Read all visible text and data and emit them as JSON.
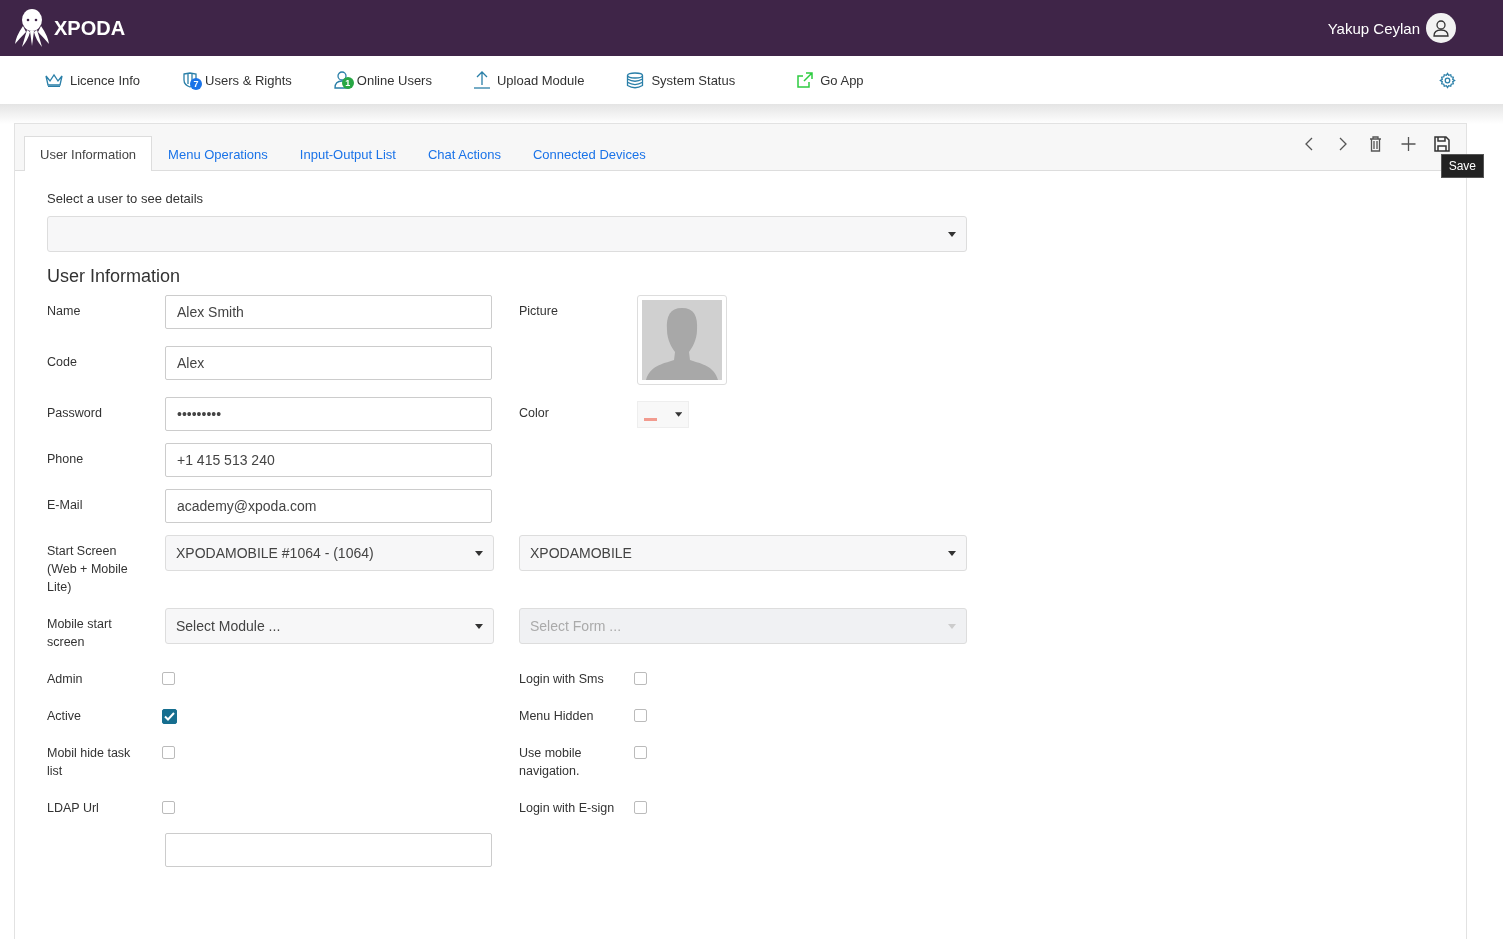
{
  "header": {
    "brand": "XPODA",
    "user_name": "Yakup Ceylan"
  },
  "nav": [
    {
      "kind": "crown",
      "label": "Licence Info"
    },
    {
      "kind": "shield",
      "label": "Users & Rights",
      "badge": "7",
      "color": "#1a73e8"
    },
    {
      "kind": "user",
      "label": "Online Users",
      "badge": "1",
      "color": "#28a745"
    },
    {
      "kind": "upload",
      "label": "Upload Module"
    },
    {
      "kind": "database",
      "label": "System Status"
    },
    {
      "kind": "external",
      "label": "Go App"
    }
  ],
  "tabs": [
    {
      "label": "User Information",
      "selected": true
    },
    {
      "label": "Menu Operations",
      "selected": false
    },
    {
      "label": "Input-Output List",
      "selected": false
    },
    {
      "label": "Chat Actions",
      "selected": false
    },
    {
      "label": "Connected Devices",
      "selected": false
    }
  ],
  "toolbar": {
    "tooltip": "Save"
  },
  "user_select": {
    "label": "Select a user to see details"
  },
  "section_title": "User Information",
  "rows": [
    {
      "left": {
        "kind": "text",
        "label": "Name",
        "value": "Alex Smith"
      },
      "right": {
        "kind": "picture",
        "label": "Picture"
      }
    },
    {
      "left": {
        "kind": "text",
        "label": "Code",
        "value": "Alex"
      }
    },
    {
      "left": {
        "kind": "text",
        "label": "Password",
        "value": "•••••••••"
      },
      "right": {
        "kind": "color",
        "label": "Color",
        "color": "#f29b8f"
      }
    },
    {
      "left": {
        "kind": "text",
        "label": "Phone",
        "value": "+1 415 513 240"
      }
    },
    {
      "left": {
        "kind": "text",
        "label": "E-Mail",
        "value": "academy@xpoda.com"
      }
    },
    {
      "left": {
        "kind": "select",
        "label": "Start Screen (Web + Mobile Lite)",
        "value": "XPODAMOBILE #1064 - (1064)"
      },
      "right": {
        "kind": "select",
        "value": "XPODAMOBILE",
        "disabled": false
      }
    },
    {
      "left": {
        "kind": "select",
        "label": "Mobile start screen",
        "placeholder": "Select Module ..."
      },
      "right": {
        "kind": "select",
        "placeholder": "Select Form ...",
        "disabled": true
      }
    },
    {
      "left": {
        "kind": "checkbox",
        "label": "Admin",
        "checked": false
      },
      "right": {
        "kind": "checkbox",
        "label": "Login with Sms",
        "checked": false
      }
    },
    {
      "left": {
        "kind": "checkbox",
        "label": "Active",
        "checked": true
      },
      "right": {
        "kind": "checkbox",
        "label": "Menu Hidden",
        "checked": false
      }
    },
    {
      "left": {
        "kind": "checkbox",
        "label": "Mobil hide task list",
        "checked": false
      },
      "right": {
        "kind": "checkbox",
        "label": "Use mobile navigation.",
        "checked": false
      }
    },
    {
      "left": {
        "kind": "checkbox",
        "label": "LDAP Url",
        "checked": false
      },
      "right": {
        "kind": "checkbox",
        "label": "Login with E-sign",
        "checked": false
      }
    },
    {
      "left": {
        "kind": "text"
      }
    }
  ]
}
